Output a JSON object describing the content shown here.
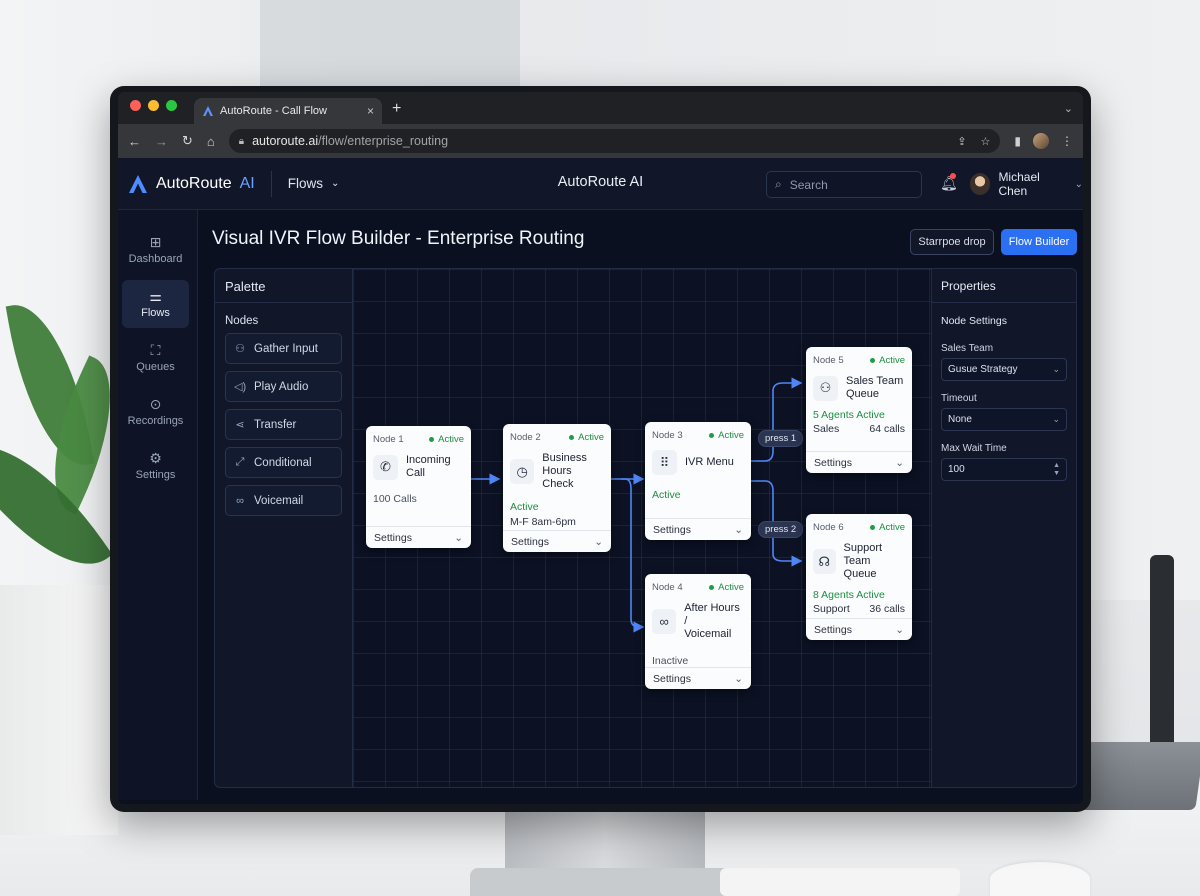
{
  "browser": {
    "tab_title": "AutoRoute - Call Flow",
    "url_host": "autoroute.ai",
    "url_path": "/flow/enterprise_routing"
  },
  "header": {
    "logo_text": "AutoRoute",
    "logo_accent": "AI",
    "flows_menu": "Flows",
    "center_title": "AutoRoute AI",
    "search_placeholder": "Search",
    "user_name": "Michael Chen"
  },
  "sidebar": {
    "items": [
      {
        "label": "Dashboard",
        "icon": "grid-icon"
      },
      {
        "label": "Flows",
        "icon": "sliders-icon",
        "active": true
      },
      {
        "label": "Queues",
        "icon": "hierarchy-icon"
      },
      {
        "label": "Recordings",
        "icon": "play-circle-icon"
      },
      {
        "label": "Settings",
        "icon": "gear-icon"
      }
    ]
  },
  "page": {
    "title": "Visual IVR Flow Builder - Enterprise Routing",
    "btn_secondary": "Starrpoe drop",
    "btn_primary": "Flow Builder"
  },
  "palette": {
    "title": "Palette",
    "section": "Nodes",
    "items": [
      {
        "label": "Gather Input",
        "icon": "person-icon"
      },
      {
        "label": "Play Audio",
        "icon": "speaker-icon"
      },
      {
        "label": "Transfer",
        "icon": "share-icon"
      },
      {
        "label": "Conditional",
        "icon": "branch-icon"
      },
      {
        "label": "Voicemail",
        "icon": "voicemail-icon"
      }
    ]
  },
  "nodes": {
    "n1": {
      "id": "Node 1",
      "status": "Active",
      "title1": "Incoming",
      "title2": "Call",
      "line1": "100 Calls",
      "footer": "Settings"
    },
    "n2": {
      "id": "Node 2",
      "status": "Active",
      "title1": "Business",
      "title2": "Hours Check",
      "line1": "Active",
      "line2": "M-F 8am-6pm",
      "footer": "Settings"
    },
    "n3": {
      "id": "Node 3",
      "status": "Active",
      "title1": "IVR Menu",
      "line1": "Active",
      "footer": "Settings"
    },
    "n4": {
      "id": "Node 4",
      "status": "Active",
      "title1": "After Hours /",
      "title2": "Voicemail",
      "line1": "Inactive",
      "footer": "Settings"
    },
    "n5": {
      "id": "Node 5",
      "status": "Active",
      "title1": "Sales Team",
      "title2": "Queue",
      "line1": "5 Agents Active",
      "line2a": "Sales",
      "line2b": "64 calls",
      "footer": "Settings"
    },
    "n6": {
      "id": "Node 6",
      "status": "Active",
      "title1": "Support Team",
      "title2": "Queue",
      "line1": "8 Agents Active",
      "line2a": "Support",
      "line2b": "36 calls",
      "footer": "Settings"
    }
  },
  "edges": {
    "press1": "press 1",
    "press2": "press 2"
  },
  "properties": {
    "title": "Properties",
    "section": "Node Settings",
    "fields": [
      {
        "label": "Sales Team",
        "value": "Gusue Strategy"
      },
      {
        "label": "Timeout",
        "value": "None"
      },
      {
        "label": "Max Wait Time",
        "value": "100"
      }
    ]
  },
  "colors": {
    "accent": "#2b6ff3",
    "active_green": "#1e8e3e",
    "wire": "#4f86f7"
  }
}
